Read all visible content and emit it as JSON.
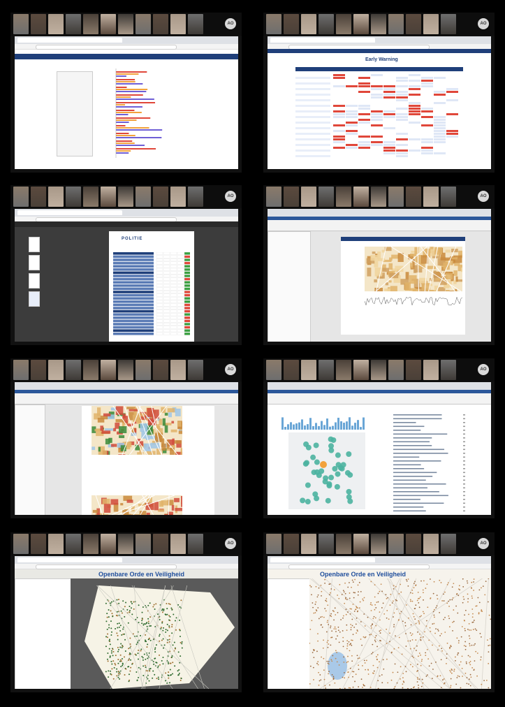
{
  "grid": {
    "tiles": [
      {
        "id": "t1",
        "title": "",
        "footer": "",
        "kind": "barchart"
      },
      {
        "id": "t2",
        "title": "Early Warning",
        "footer": "",
        "kind": "table"
      },
      {
        "id": "t3",
        "title": "POLITIE",
        "kind": "pdf"
      },
      {
        "id": "t4",
        "title": "",
        "kind": "mapchart"
      },
      {
        "id": "t5",
        "title": "",
        "kind": "doc-map"
      },
      {
        "id": "t6",
        "title": "",
        "kind": "clusters"
      },
      {
        "id": "t7",
        "title": "Openbare Orde en Veiligheid",
        "kind": "map-dark"
      },
      {
        "id": "t8",
        "title": "Openbare Orde en Veiligheid",
        "kind": "map-light"
      }
    ],
    "participant_badge": "AO"
  },
  "colors": {
    "navy": "#1f3f7a",
    "red": "#e0473a",
    "orange": "#f2a23c",
    "purple": "#6f5fd6",
    "teal": "#4bb3a0",
    "map_beige": "#f4e6c8"
  }
}
